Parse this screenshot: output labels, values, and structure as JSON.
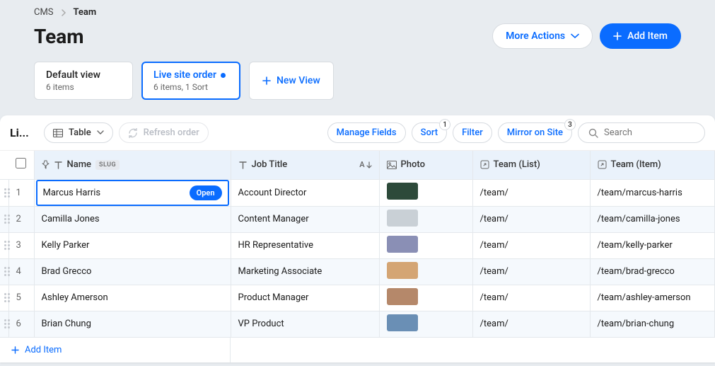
{
  "breadcrumb": {
    "root": "CMS",
    "current": "Team"
  },
  "page_title": "Team",
  "buttons": {
    "more_actions": "More Actions",
    "add_item": "Add Item",
    "new_view": "New View",
    "refresh": "Refresh order",
    "manage_fields": "Manage Fields",
    "sort": "Sort",
    "filter": "Filter",
    "mirror": "Mirror on Site",
    "open": "Open",
    "add_item_row": "Add Item"
  },
  "badges": {
    "sort": "1",
    "mirror": "3"
  },
  "views": {
    "default": {
      "name": "Default view",
      "sub": "6 items"
    },
    "live": {
      "name": "Live site order",
      "sub": "6 items, 1 Sort"
    }
  },
  "toolbar": {
    "tab_name": "Li...",
    "display_mode": "Table",
    "search_placeholder": "Search"
  },
  "columns": {
    "name": "Name",
    "slug_tag": "SLUG",
    "job": "Job Title",
    "photo": "Photo",
    "team_list": "Team (List)",
    "team_item": "Team (Item)"
  },
  "rows": [
    {
      "idx": "1",
      "name": "Marcus Harris",
      "job": "Account Director",
      "photo": "#2d4a3a",
      "list": "/team/",
      "item": "/team/marcus-harris",
      "selected": true
    },
    {
      "idx": "2",
      "name": "Camilla Jones",
      "job": "Content Manager",
      "photo": "#c9d0d6",
      "list": "/team/",
      "item": "/team/camilla-jones"
    },
    {
      "idx": "3",
      "name": "Kelly Parker",
      "job": "HR Representative",
      "photo": "#8a8fb5",
      "list": "/team/",
      "item": "/team/kelly-parker"
    },
    {
      "idx": "4",
      "name": "Brad Grecco",
      "job": "Marketing Associate",
      "photo": "#d4a574",
      "list": "/team/",
      "item": "/team/brad-grecco"
    },
    {
      "idx": "5",
      "name": "Ashley Amerson",
      "job": "Product Manager",
      "photo": "#b5886a",
      "list": "/team/",
      "item": "/team/ashley-amerson"
    },
    {
      "idx": "6",
      "name": "Brian Chung",
      "job": "VP Product",
      "photo": "#6a8fb5",
      "list": "/team/",
      "item": "/team/brian-chung"
    }
  ]
}
